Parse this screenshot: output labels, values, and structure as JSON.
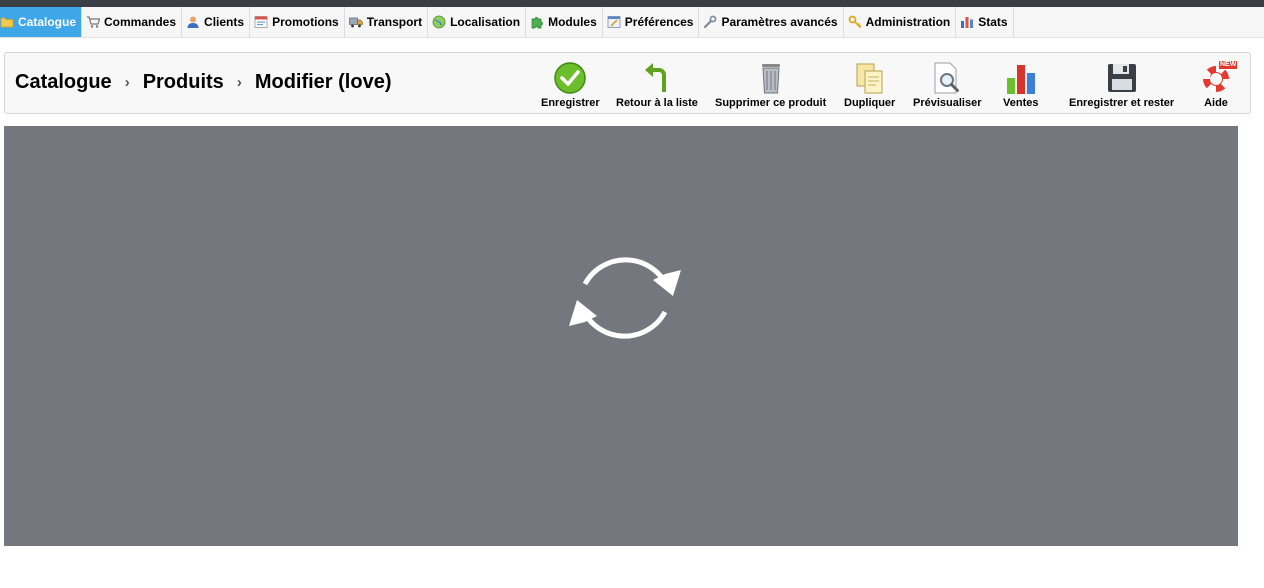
{
  "nav": {
    "tabs": [
      {
        "label": "Catalogue",
        "active": true,
        "icon": "folder-icon"
      },
      {
        "label": "Commandes",
        "icon": "cart-icon"
      },
      {
        "label": "Clients",
        "icon": "user-icon"
      },
      {
        "label": "Promotions",
        "icon": "promotion-icon"
      },
      {
        "label": "Transport",
        "icon": "truck-icon"
      },
      {
        "label": "Localisation",
        "icon": "globe-icon"
      },
      {
        "label": "Modules",
        "icon": "puzzle-icon"
      },
      {
        "label": "Préférences",
        "icon": "preferences-icon"
      },
      {
        "label": "Paramètres avancés",
        "icon": "wrench-icon"
      },
      {
        "label": "Administration",
        "icon": "key-icon"
      },
      {
        "label": "Stats",
        "icon": "bar-chart-icon"
      }
    ]
  },
  "breadcrumb": {
    "items": [
      "Catalogue",
      "Produits",
      "Modifier (love)"
    ],
    "separator": "›"
  },
  "toolbar": {
    "buttons": [
      {
        "label": "Enregistrer",
        "icon": "check-icon"
      },
      {
        "label": "Retour à la liste",
        "icon": "back-arrow-icon"
      },
      {
        "label": "Supprimer ce produit",
        "icon": "trash-icon"
      },
      {
        "label": "Dupliquer",
        "icon": "duplicate-icon"
      },
      {
        "label": "Prévisualiser",
        "icon": "preview-icon"
      },
      {
        "label": "Ventes",
        "icon": "sales-chart-icon"
      },
      {
        "label": "Enregistrer et rester",
        "icon": "floppy-disk-icon"
      },
      {
        "label": "Aide",
        "icon": "lifebuoy-icon",
        "badge": "NEW"
      }
    ]
  },
  "loading": {
    "icon": "refresh-spinner-icon"
  },
  "colors": {
    "active_tab": "#3fa7e8",
    "overlay": "#74787e",
    "save_green": "#6cbf2a"
  }
}
